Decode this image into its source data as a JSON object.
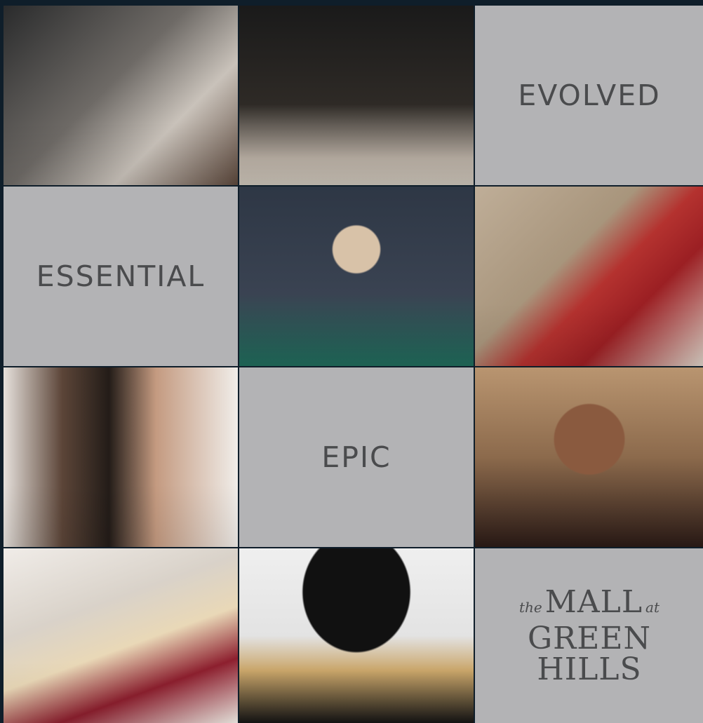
{
  "tiles": {
    "r1c3": {
      "word": "EVOLVED"
    },
    "r2c1": {
      "word": "ESSENTIAL"
    },
    "r3c2": {
      "word": "EPIC"
    }
  },
  "logo": {
    "the": "the",
    "mall": "MALL",
    "at": "at",
    "green_hills": "GREEN HILLS"
  },
  "colors": {
    "tile_gray": "#b3b3b5",
    "text_gray": "#4a4b4d",
    "background": "#0f1e2a"
  },
  "images": {
    "r1c1": "woman-portrait-photo",
    "r1c2": "high-heels-photo",
    "r2c2": "woman-in-gown-photo",
    "r2c3": "red-handbag-photo",
    "r3c1": "couple-photo",
    "r3c3": "smiling-woman-photo",
    "r4c1": "cheesecake-photo",
    "r4c2": "woman-with-hat-photo"
  }
}
